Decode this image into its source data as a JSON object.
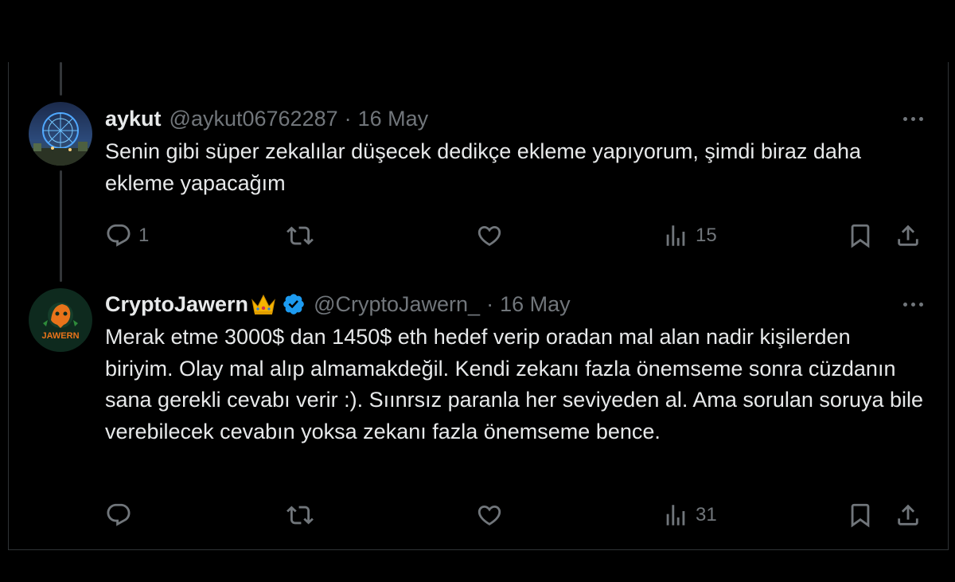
{
  "tweets": [
    {
      "name": "aykut",
      "handle": "@aykut06762287",
      "separator": "·",
      "date": "16 May",
      "text": "Senin gibi süper zekalılar düşecek dedikçe ekleme yapıyorum, şimdi biraz daha ekleme yapacağım",
      "reply_count": "1",
      "retweet_count": "",
      "like_count": "",
      "view_count": "15",
      "avatar_icon": "ferris-wheel-photo"
    },
    {
      "name": "CryptoJawern",
      "badge_emoji": "crown-emoji",
      "verified": true,
      "handle": "@CryptoJawern_",
      "separator": "·",
      "date": "16 May",
      "text": "Merak etme 3000$ dan 1450$ eth hedef verip oradan mal alan nadir kişilerden biriyim. Olay mal alıp almamakdeğil. Kendi zekanı fazla önemseme sonra cüzdanın sana gerekli cevabı verir :). Sıınrsız paranla her seviyeden al. Ama sorulan soruya bile verebilecek cevabın yoksa zekanı fazla önemseme bence.",
      "avatar_text": "JAWERN",
      "reply_count": "",
      "retweet_count": "",
      "like_count": "",
      "view_count": "31"
    }
  ],
  "colors": {
    "background": "#000000",
    "text": "#e7e9ea",
    "muted": "#71767b",
    "verified": "#1d9bf0",
    "crown": "#f5b400"
  }
}
